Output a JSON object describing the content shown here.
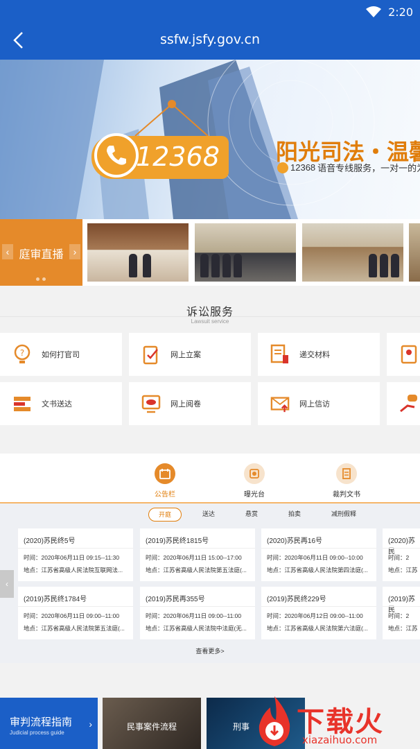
{
  "status_bar": {
    "time": "2:20"
  },
  "url_bar": {
    "url": "ssfw.jsfy.gov.cn"
  },
  "banner": {
    "hotline": "12368",
    "title": "阳光司法・温馨",
    "subtitle_hotline": "12368",
    "subtitle": "语音专线服务，一对一的为"
  },
  "live": {
    "label": "庭审直播"
  },
  "services": {
    "title": "诉讼服务",
    "subtitle": "Lawsuit service",
    "items": [
      {
        "label": "如何打官司",
        "icon": "question-bulb-icon"
      },
      {
        "label": "网上立案",
        "icon": "clipboard-edit-icon"
      },
      {
        "label": "递交材料",
        "icon": "documents-icon"
      },
      {
        "label": "",
        "icon": "id-card-icon"
      },
      {
        "label": "文书送达",
        "icon": "send-document-icon"
      },
      {
        "label": "网上阅卷",
        "icon": "monitor-eye-icon"
      },
      {
        "label": "网上信访",
        "icon": "envelope-upload-icon"
      },
      {
        "label": "",
        "icon": "hand-chat-icon"
      }
    ]
  },
  "notice": {
    "tabs": [
      {
        "label": "公告栏",
        "active": true
      },
      {
        "label": "曝光台",
        "active": false
      },
      {
        "label": "裁判文书",
        "active": false
      }
    ],
    "subtabs": [
      "开庭",
      "送达",
      "悬赏",
      "拍卖",
      "减刑假释"
    ],
    "cases": [
      {
        "no": "(2020)苏民终5号",
        "time": "时间：2020年06月11日 09:15--11:30",
        "place": "地点：江苏省高级人民法院互联网法..."
      },
      {
        "no": "(2019)苏民终1815号",
        "time": "时间：2020年06月11日 15:00--17:00",
        "place": "地点：江苏省高级人民法院第五法庭(..."
      },
      {
        "no": "(2020)苏民再16号",
        "time": "时间：2020年06月11日 09:00--10:00",
        "place": "地点：江苏省高级人民法院第四法庭(..."
      },
      {
        "no": "(2020)苏民",
        "time": "时间：2",
        "place": "地点：江苏"
      },
      {
        "no": "(2019)苏民终1784号",
        "time": "时间：2020年06月11日 09:00--11:00",
        "place": "地点：江苏省高级人民法院第五法庭(..."
      },
      {
        "no": "(2019)苏民再355号",
        "time": "时间：2020年06月11日 09:00--11:00",
        "place": "地点：江苏省高级人民法院中法庭(无..."
      },
      {
        "no": "(2019)苏民终229号",
        "time": "时间：2020年06月12日 09:00--11:00",
        "place": "地点：江苏省高级人民法院第六法庭(..."
      },
      {
        "no": "(2019)苏民",
        "time": "时间：2",
        "place": "地点：江苏"
      }
    ],
    "more": "查看更多>"
  },
  "guide": {
    "main_title": "审判流程指南",
    "main_subtitle": "Judicial process guide",
    "civil": "民事案件流程",
    "criminal": "刑事"
  },
  "watermark": {
    "logo": "下载火",
    "url": "xiazaihuo.com"
  },
  "colors": {
    "brand_blue": "#1b5fc7",
    "accent_orange": "#e58a2a",
    "watermark_red": "#e8332a"
  }
}
